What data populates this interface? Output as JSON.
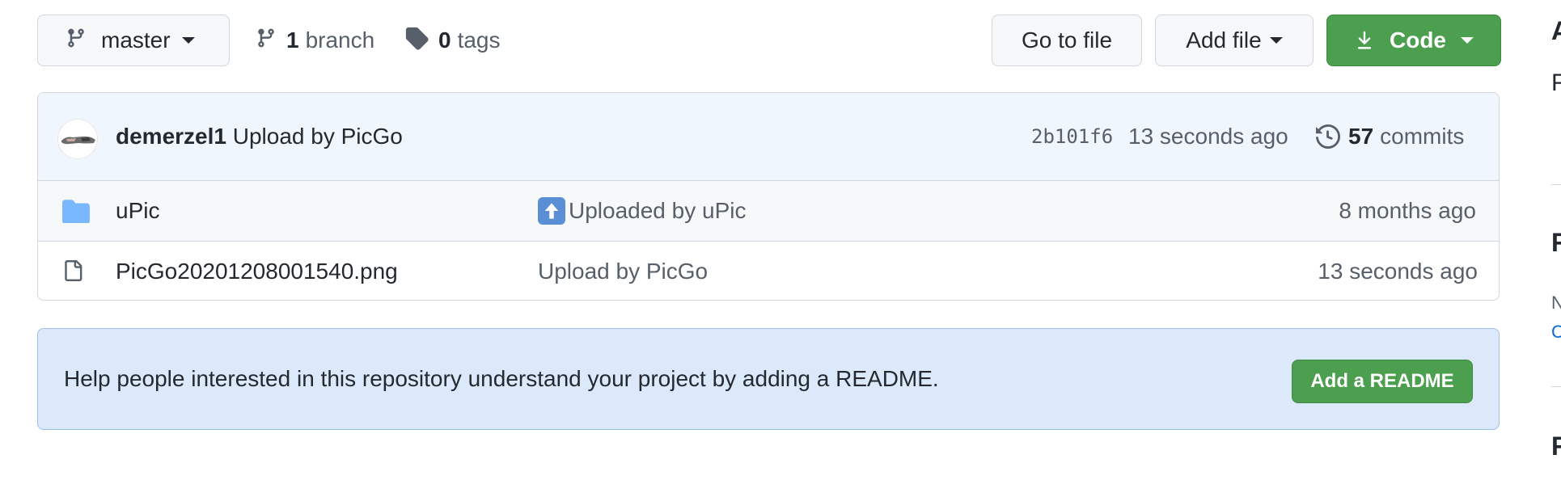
{
  "toolbar": {
    "branch_name": "master",
    "branch_count": "1",
    "branch_word": "branch",
    "tag_count": "0",
    "tag_word": "tags",
    "go_to_file": "Go to file",
    "add_file": "Add file",
    "code": "Code"
  },
  "commit": {
    "author": "demerzel1",
    "message": "Upload by PicGo",
    "sha": "2b101f6",
    "time": "13 seconds ago",
    "commit_count": "57",
    "commit_word": "commits"
  },
  "files": [
    {
      "type": "folder",
      "name": "uPic",
      "message": "Uploaded by uPic",
      "age": "8 months ago",
      "icon": "folder-icon"
    },
    {
      "type": "file",
      "name": "PicGo20201208001540.png",
      "message": "Upload by PicGo",
      "age": "13 seconds ago",
      "icon": "file-icon"
    }
  ],
  "readme": {
    "text": "Help people interested in this repository understand your project by adding a README.",
    "button": "Add a README"
  },
  "sidebar": {
    "heading_1": "A",
    "text_1": "F",
    "heading_2": "F",
    "small_1": "N",
    "link_1": "C",
    "heading_3": "F"
  },
  "colors": {
    "accent_green": "#4b9f4f",
    "readme_bg": "#dce9fb",
    "commit_bg": "#f0f6fe",
    "folder_blue": "#79b8ff"
  }
}
